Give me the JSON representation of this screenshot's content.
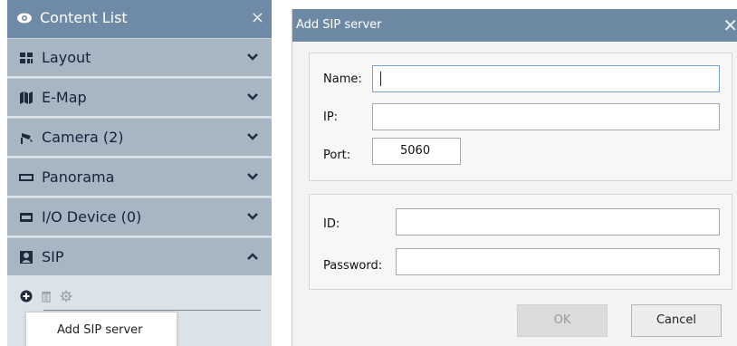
{
  "content_list": {
    "title": "Content List",
    "close_glyph": "×",
    "items": [
      {
        "label": "Layout",
        "icon": "layout-icon",
        "chevron": "down"
      },
      {
        "label": "E-Map",
        "icon": "map-icon",
        "chevron": "down"
      },
      {
        "label": "Camera (2)",
        "icon": "camera-icon",
        "chevron": "down"
      },
      {
        "label": "Panorama",
        "icon": "panorama-icon",
        "chevron": "down"
      },
      {
        "label": "I/O Device (0)",
        "icon": "io-device-icon",
        "chevron": "down"
      },
      {
        "label": "SIP",
        "icon": "sip-icon",
        "chevron": "up"
      }
    ],
    "sip_tools": [
      "add-icon",
      "trash-icon",
      "gear-icon"
    ],
    "context_menu": {
      "item": "Add SIP server"
    }
  },
  "dialog": {
    "title": "Add SIP server",
    "close_glyph": "✕",
    "fields": {
      "name_label": "Name:",
      "name_value": "",
      "ip_label": "IP:",
      "ip_value": "",
      "port_label": "Port:",
      "port_value": "5060",
      "id_label": "ID:",
      "id_value": "",
      "password_label": "Password:",
      "password_value": ""
    },
    "buttons": {
      "ok": "OK",
      "cancel": "Cancel"
    }
  },
  "colors": {
    "header_blue": "#6f8aa6",
    "accordion_grey_blue": "#a8b6c4",
    "dialog_bg": "#f3f3f3"
  }
}
